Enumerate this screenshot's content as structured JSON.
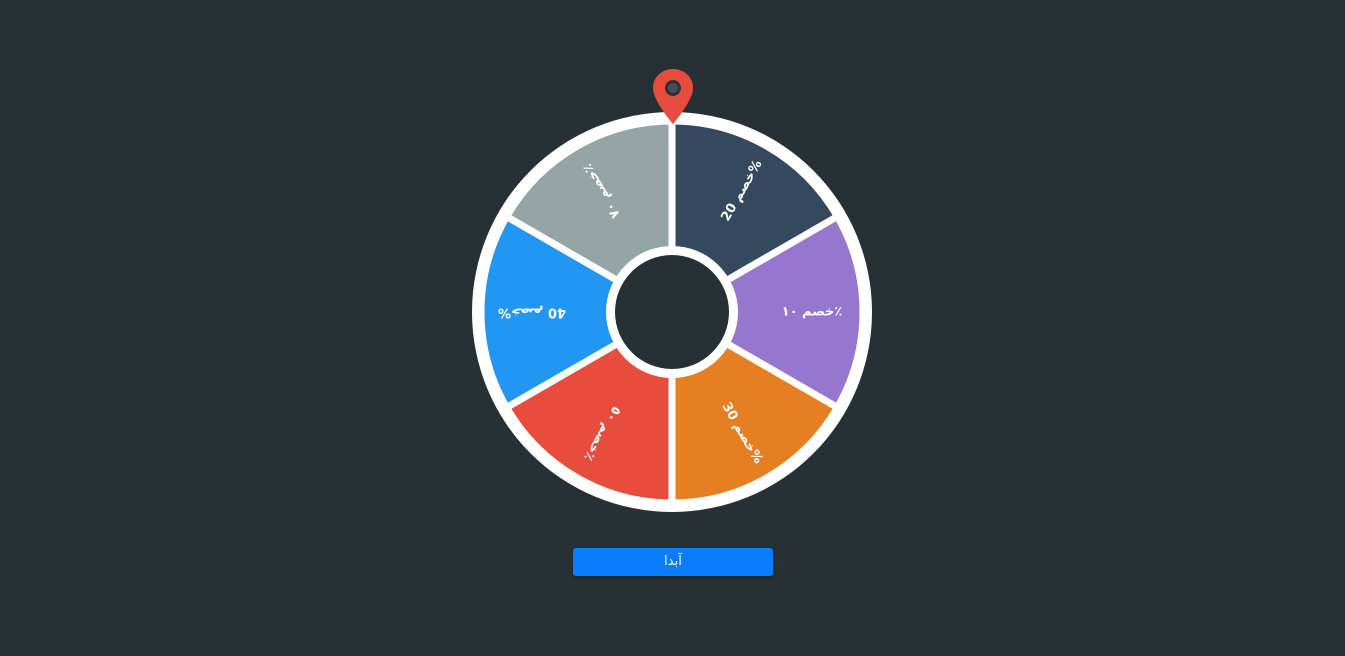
{
  "wheel": {
    "segments": [
      {
        "label": "خصم 20%",
        "color": "#34495e"
      },
      {
        "label": "خصم ١٠٪",
        "color": "#9776d0"
      },
      {
        "label": "خصم 30%",
        "color": "#e67e22"
      },
      {
        "label": "خصم ٥٠٪",
        "color": "#e74c3c"
      },
      {
        "label": "خصم 40%",
        "color": "#2196f3"
      },
      {
        "label": "خصم ٧٠٪",
        "color": "#95a5a6"
      }
    ],
    "rim_color": "#ffffff",
    "hub_color": "#263035"
  },
  "pointer": {
    "icon": "map-marker-icon",
    "color": "#e74c3c"
  },
  "controls": {
    "spin_label": "آبدا",
    "color": "#0a7cff"
  }
}
